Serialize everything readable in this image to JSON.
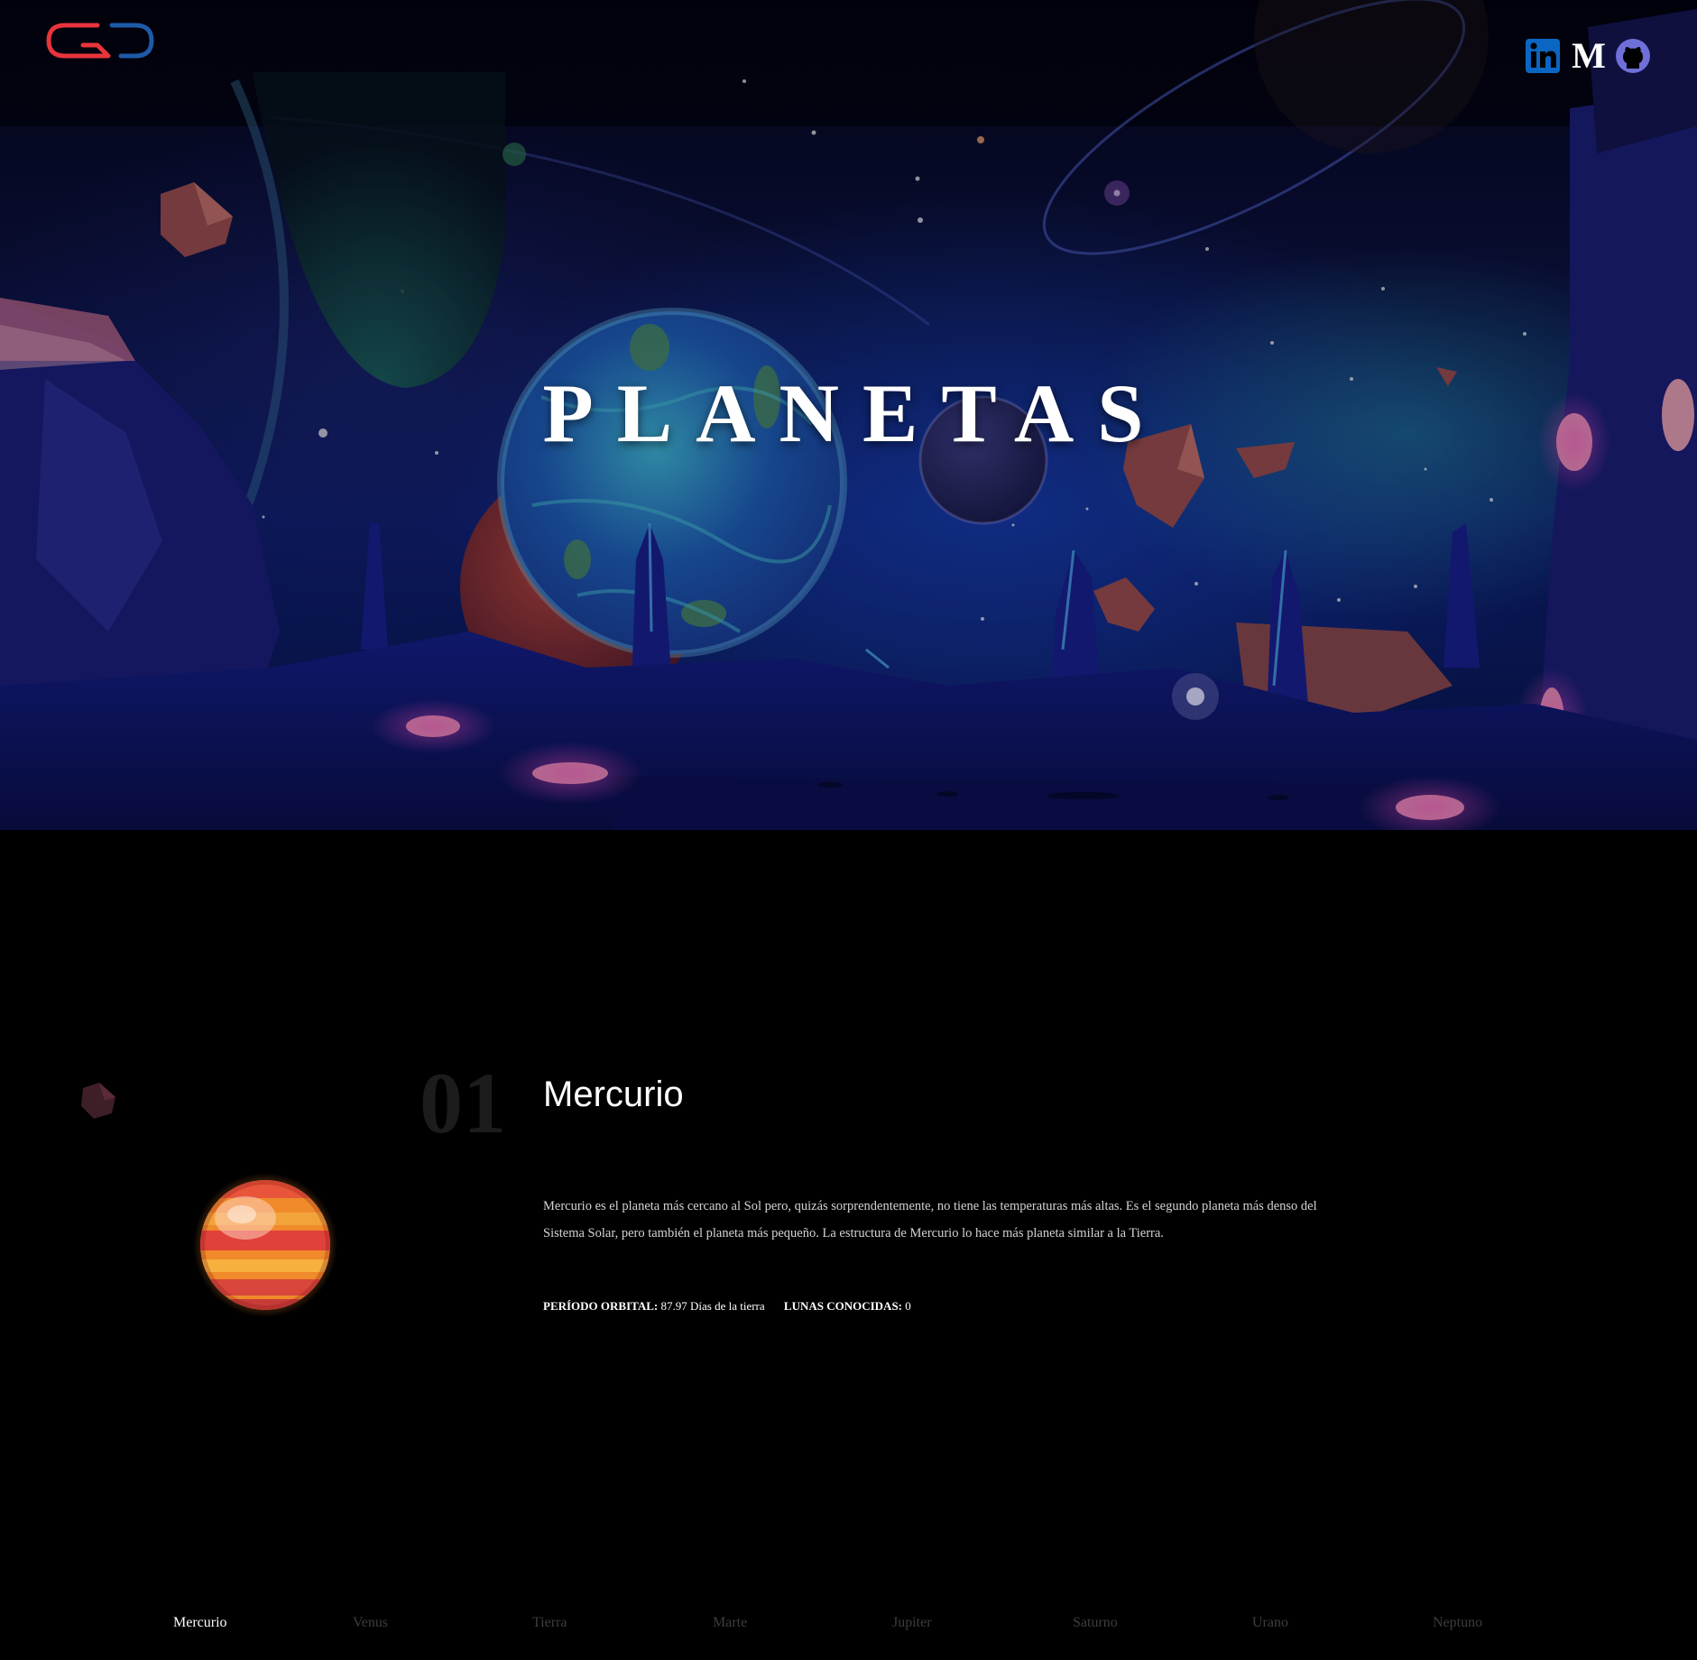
{
  "hero": {
    "title": "PLANETAS"
  },
  "header": {
    "logo_icon": "gd-logo-icon",
    "social_icons": [
      "linkedin-icon",
      "medium-icon",
      "github-icon"
    ],
    "medium_glyph": "M"
  },
  "planet": {
    "number": "01",
    "name": "Mercurio",
    "description": "Mercurio es el planeta más cercano al Sol pero, quizás sorprendentemente, no tiene las temperaturas más altas. Es el segundo planeta más denso del Sistema Solar, pero también el planeta más pequeño. La estructura de Mercurio lo hace más planeta similar a la Tierra.",
    "orbital_label": "PERÍODO ORBITAL:",
    "orbital_value": "87.97 Días de la tierra",
    "moons_label": "LUNAS CONOCIDAS:",
    "moons_value": "0"
  },
  "nav": {
    "tabs": [
      "Mercurio",
      "Venus",
      "Tierra",
      "Marte",
      "Jupiter",
      "Saturno",
      "Urano",
      "Neptuno"
    ],
    "active": "Mercurio"
  },
  "colors": {
    "background": "#000000",
    "logo_red": "#e8343c",
    "logo_blue": "#1d5aa8",
    "linkedin": "#0a66c2",
    "github": "#6e6fd8",
    "inactive_tab": "#3d3d3d",
    "number": "#1c1c1c"
  }
}
